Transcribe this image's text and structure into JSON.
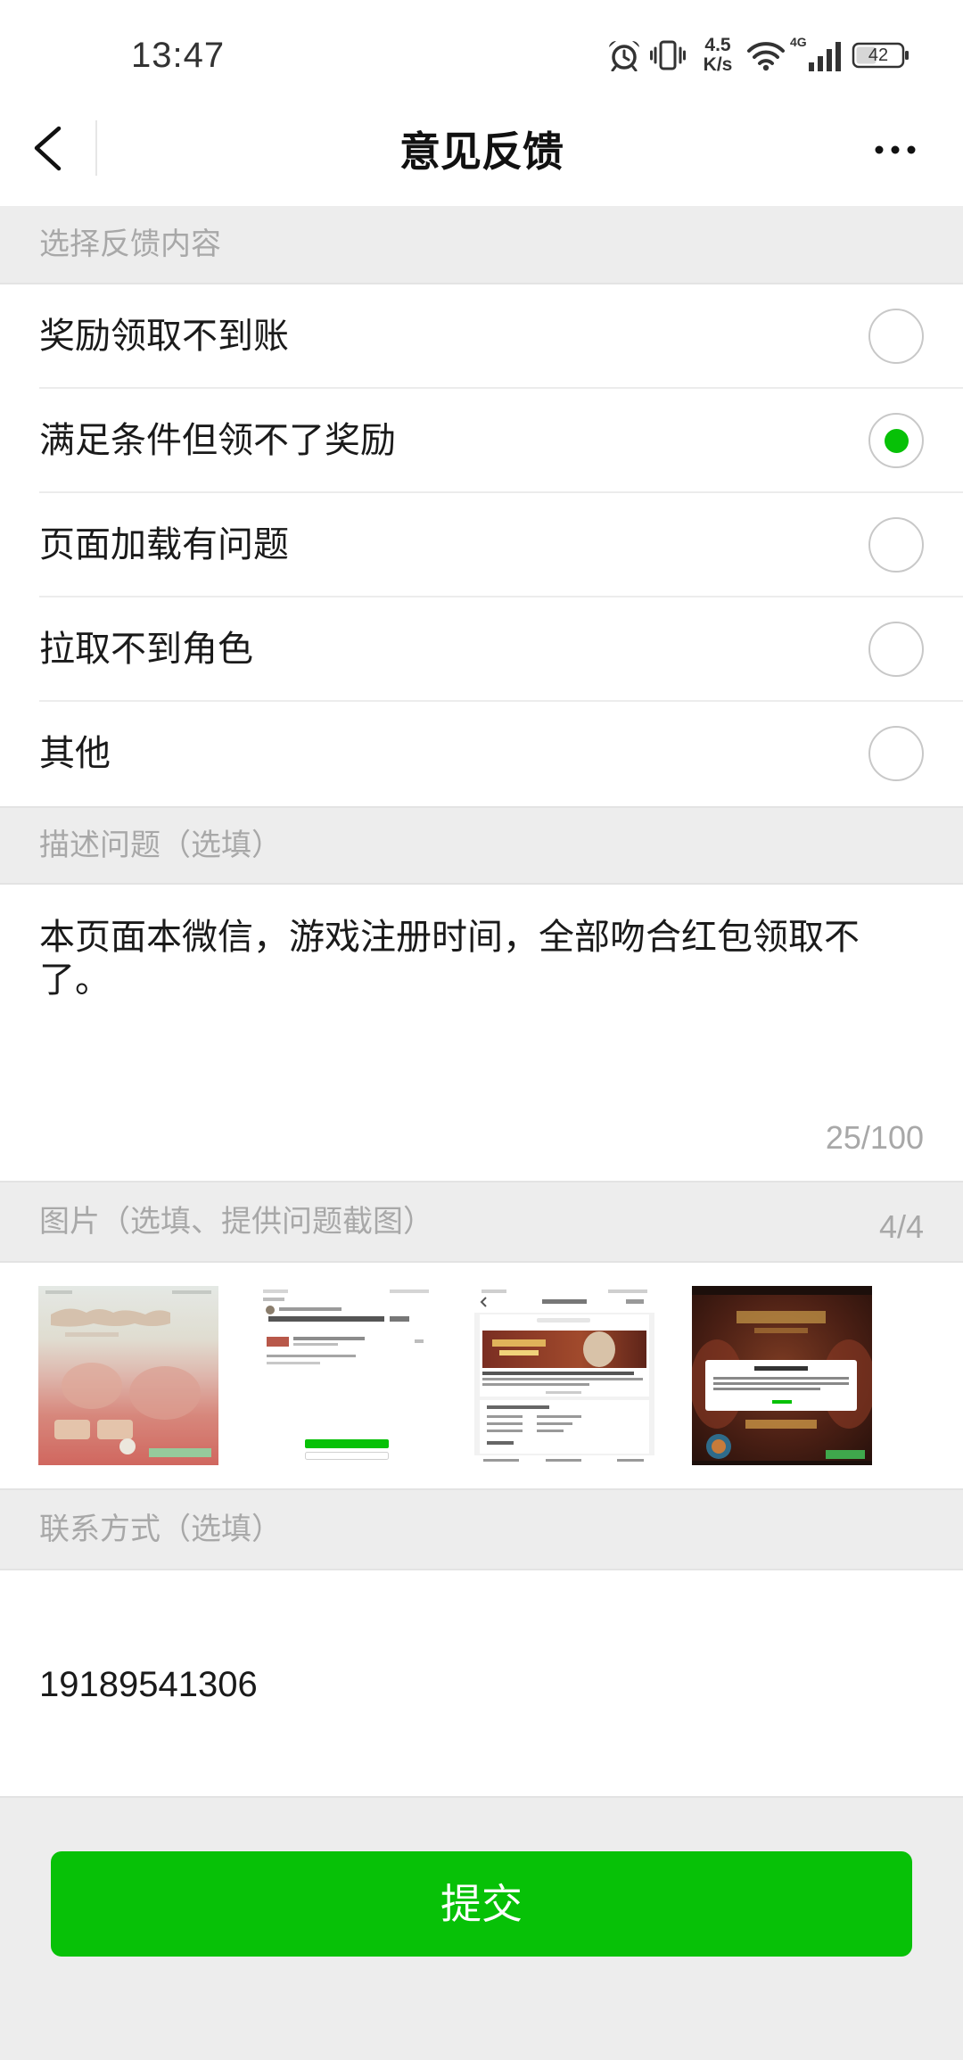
{
  "status_bar": {
    "time": "13:47",
    "net_speed_value": "4.5",
    "net_speed_unit": "K/s",
    "network_type": "4G",
    "battery_level": "42",
    "icons": [
      "alarm-icon",
      "vibrate-icon",
      "wifi-icon",
      "signal-icon",
      "battery-icon"
    ]
  },
  "header": {
    "title": "意见反馈",
    "back_icon": "chevron-left-icon",
    "more_icon": "more-icon"
  },
  "feedback_type": {
    "label": "选择反馈内容",
    "options": [
      {
        "label": "奖励领取不到账",
        "selected": false
      },
      {
        "label": "满足条件但领不了奖励",
        "selected": true
      },
      {
        "label": "页面加载有问题",
        "selected": false
      },
      {
        "label": "拉取不到角色",
        "selected": false
      },
      {
        "label": "其他",
        "selected": false
      }
    ]
  },
  "description": {
    "label": "描述问题（选填）",
    "value": "本页面本微信，游戏注册时间，全部吻合红包领取不了。",
    "counter": "25/100"
  },
  "images": {
    "label": "图片（选填、提供问题截图）",
    "counter": "4/4"
  },
  "contact": {
    "label": "联系方式（选填）",
    "value": "19189541306"
  },
  "submit": {
    "label": "提交"
  },
  "colors": {
    "accent": "#07c107",
    "page_background": "#ededed",
    "muted_text": "#a8a8a8"
  }
}
